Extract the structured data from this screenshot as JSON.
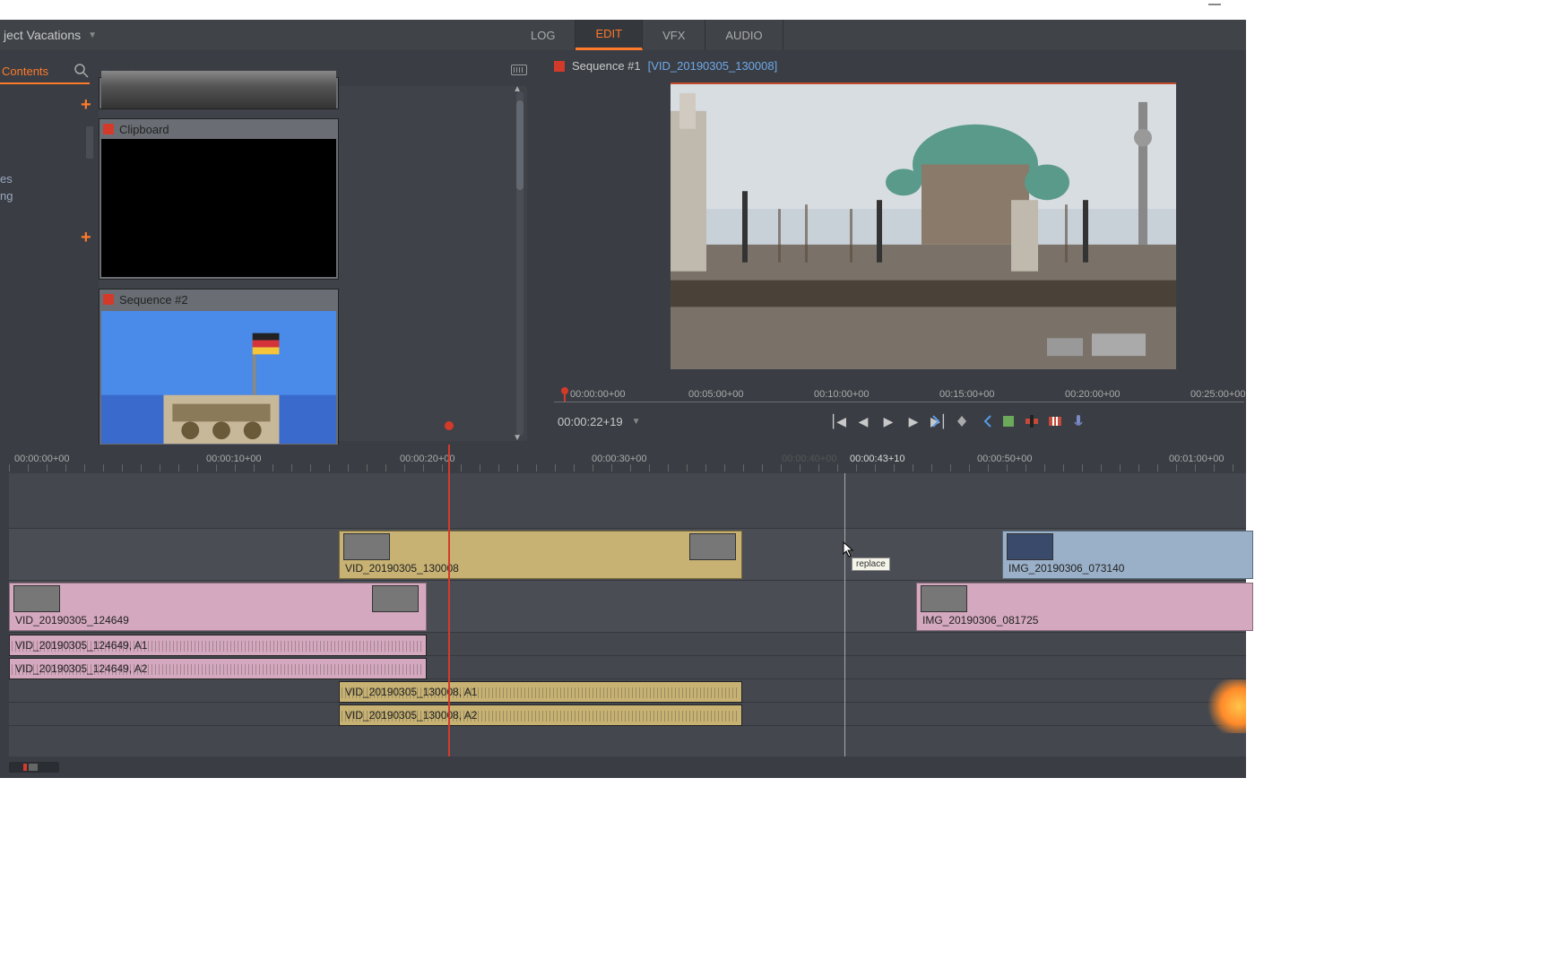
{
  "project": {
    "title": "ject Vacations"
  },
  "modeTabs": {
    "log": "LOG",
    "edit": "EDIT",
    "vfx": "VFX",
    "audio": "AUDIO"
  },
  "contents": {
    "label": "Contents"
  },
  "sideNav": {
    "item1": "es",
    "item2": "ng"
  },
  "bins": {
    "clipboard": "Clipboard",
    "sequence2": "Sequence #2"
  },
  "viewer": {
    "sequence": "Sequence #1",
    "clip": "[VID_20190305_130008]",
    "timecode": "00:00:22+19",
    "ruler": {
      "t0": "00:00:00+00",
      "t5": "00:05:00+00",
      "t10": "00:10:00+00",
      "t15": "00:15:00+00",
      "t20": "00:20:00+00",
      "t25": "00:25:00+00"
    }
  },
  "timeline": {
    "ruler": {
      "t0": "00:00:00+00",
      "t10": "00:00:10+00",
      "t20": "00:00:20+00",
      "t30": "00:00:30+00",
      "t40": "00:00:40+00",
      "cursor": "00:00:43+10",
      "t50": "00:00:50+00",
      "t60": "00:01:00+00"
    },
    "clips": {
      "v1a": "VID_20190305_130008",
      "v1b": "IMG_20190306_073140",
      "v2a": "VID_20190305_124649",
      "v2b": "IMG_20190306_081725",
      "a1": "VID_20190305_124649, A1",
      "a2": "VID_20190305_124649, A2",
      "a3": "VID_20190305_130008, A1",
      "a4": "VID_20190305_130008, A2"
    }
  },
  "tooltip": "replace"
}
